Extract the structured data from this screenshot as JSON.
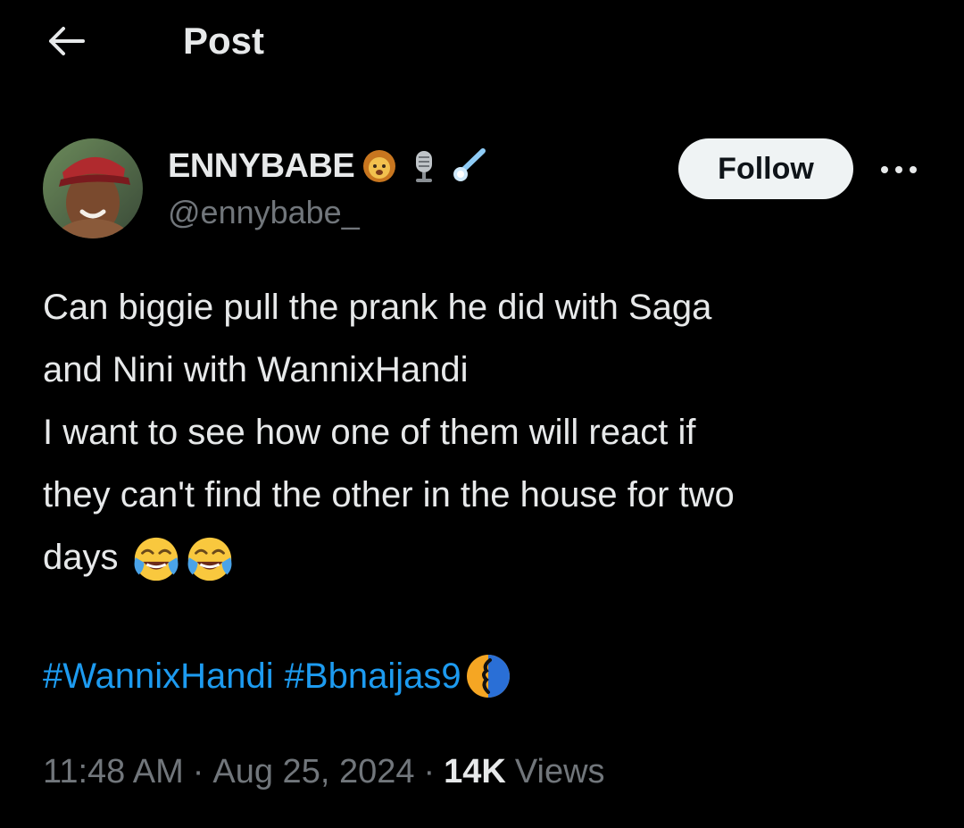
{
  "header": {
    "title": "Post",
    "back_icon": "arrow-left-icon"
  },
  "author": {
    "display_name": "ENNYBABE",
    "handle": "@ennybabe_",
    "badges": [
      "lion-face-icon",
      "microphone-icon",
      "comet-icon"
    ],
    "avatar": "avatar-photo"
  },
  "actions": {
    "follow_label": "Follow",
    "more_icon": "more-options-icon"
  },
  "tweet": {
    "lines": [
      "Can biggie pull the prank he did with Saga",
      "and Nini with WannixHandi",
      "I want to see how one of them will react if",
      "they can't find the other in the house for two",
      "days"
    ],
    "trailing_emojis": [
      "face-with-tears-of-joy-icon",
      "face-with-tears-of-joy-icon"
    ],
    "hashtags": [
      "#WannixHandi",
      "#Bbnaijas9"
    ],
    "hashtag_emoji": "bbnaija-logo-icon"
  },
  "meta": {
    "time": "11:48 AM",
    "separator": "·",
    "date": "Aug 25, 2024",
    "views_count": "14K",
    "views_label": "Views"
  },
  "colors": {
    "background": "#000000",
    "text_primary": "#e7e9ea",
    "text_secondary": "#71767b",
    "accent": "#1d9bf0",
    "follow_bg": "#eff3f4"
  }
}
